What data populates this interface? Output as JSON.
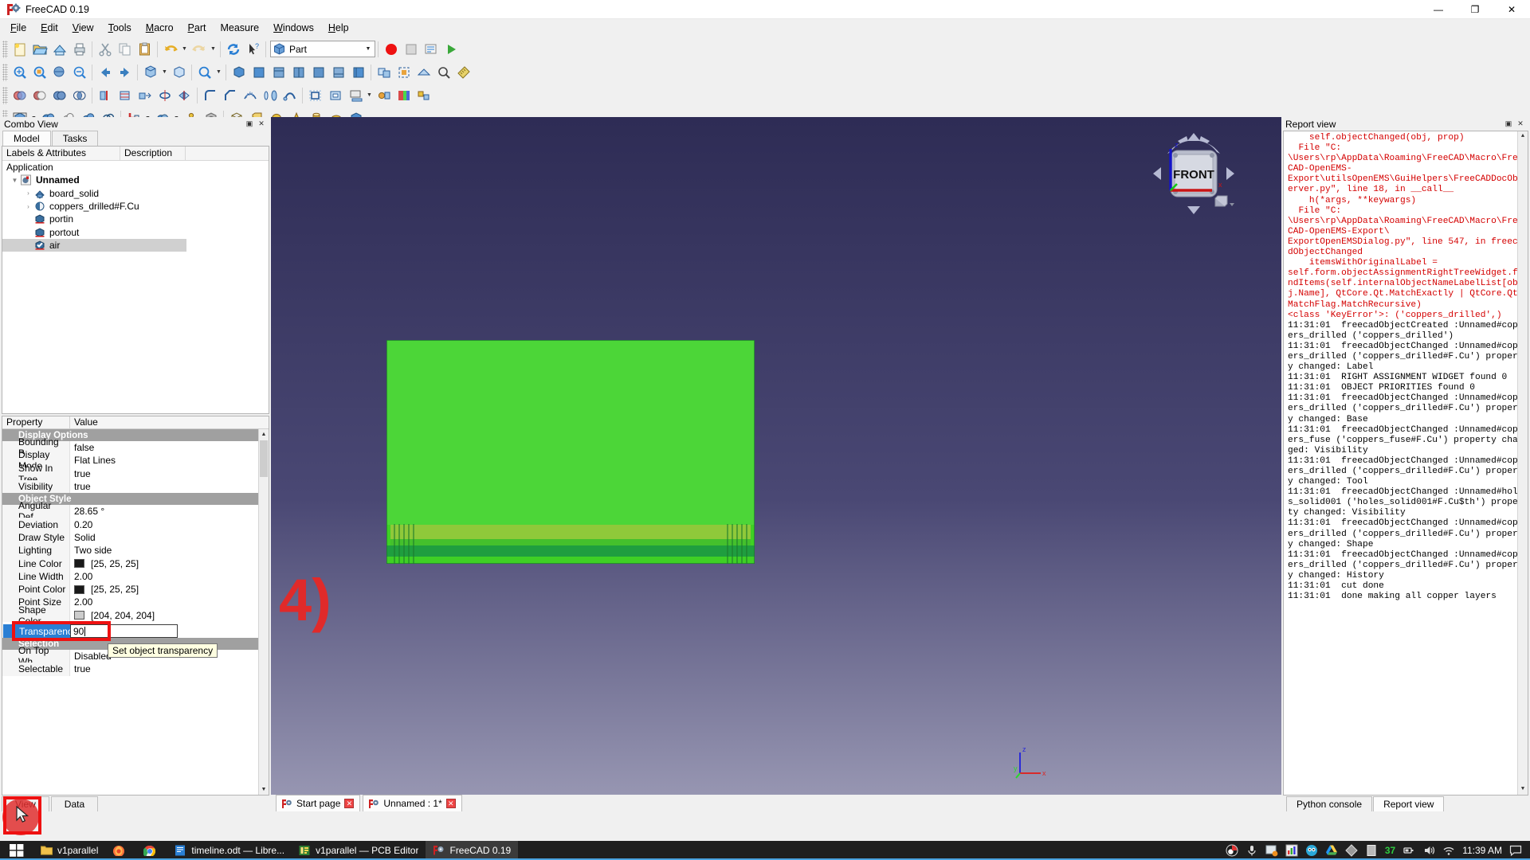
{
  "window": {
    "title": "FreeCAD 0.19",
    "icon": "freecad-icon",
    "minimize": "—",
    "maximize": "❐",
    "close": "✕"
  },
  "menubar": {
    "items": [
      {
        "label": "File",
        "mnemonic": "F"
      },
      {
        "label": "Edit",
        "mnemonic": "E"
      },
      {
        "label": "View",
        "mnemonic": "V"
      },
      {
        "label": "Tools",
        "mnemonic": "T"
      },
      {
        "label": "Macro",
        "mnemonic": "M"
      },
      {
        "label": "Part",
        "mnemonic": "P"
      },
      {
        "label": "Measure",
        "mnemonic": "M"
      },
      {
        "label": "Windows",
        "mnemonic": "W"
      },
      {
        "label": "Help",
        "mnemonic": "H"
      }
    ]
  },
  "toolbar": {
    "workbench_selector": {
      "value": "Part",
      "icon": "part-workbench-icon"
    },
    "file_buttons": [
      "new-document-icon",
      "open-document-icon",
      "save-document-icon",
      "print-icon",
      "cut-icon",
      "copy-icon",
      "paste-icon",
      "undo-icon",
      "redo-icon",
      "refresh-icon",
      "whats-this-icon"
    ],
    "macro_buttons": [
      "macro-record-icon",
      "macro-stop-icon",
      "macro-edit-icon",
      "macro-execute-icon"
    ],
    "row2_buttons": [
      "fit-all-icon",
      "fit-selection-icon",
      "draw-style-icon",
      "freeze-view-icon",
      "back-arrow-icon",
      "forward-arrow-icon",
      "std-views-icon",
      "axonometric-icon",
      "zoom-icon",
      "isometric-view-icon",
      "front-view-icon",
      "top-view-icon",
      "right-view-icon",
      "rear-view-icon",
      "bottom-view-icon",
      "left-view-icon",
      "measure-icon",
      "box-element-icon",
      "box-selection-icon",
      "clipping-plane-icon",
      "scene-inspector-icon"
    ],
    "row3_buttons": [
      "boolean-icon",
      "cut-icon",
      "union-icon",
      "common-icon",
      "section-icon",
      "cross-sections-icon",
      "extrude-icon",
      "revolve-icon",
      "mirror-icon",
      "fillet-icon",
      "chamfer-icon",
      "ruled-surface-icon",
      "loft-icon",
      "sweep-icon",
      "offset-icon",
      "thickness-icon",
      "projection-icon",
      "attachment-icon",
      "color-per-face-icon",
      "shape-builder-icon"
    ],
    "row4_buttons": [
      "primitives-icon",
      "sphere-icon",
      "ellipsoid-icon",
      "cylinder-icon",
      "cone-icon",
      "torus-icon",
      "tube-icon",
      "box-icon",
      "cube-icon",
      "cylinder2-icon",
      "cone2-icon",
      "sphere2-icon",
      "wedge-icon"
    ]
  },
  "combo_view": {
    "title": "Combo View",
    "float_btn": "float-icon",
    "close_btn": "close-icon",
    "tabs": [
      {
        "label": "Model",
        "active": true
      },
      {
        "label": "Tasks",
        "active": false
      }
    ],
    "tree": {
      "headers": [
        "Labels & Attributes",
        "Description",
        ""
      ],
      "items": [
        {
          "label": "Application",
          "indent": 0,
          "expander": "",
          "icon": "",
          "bold": false,
          "selected": false
        },
        {
          "label": "Unnamed",
          "indent": 1,
          "expander": "▾",
          "icon": "document-icon",
          "bold": true,
          "selected": false
        },
        {
          "label": "board_solid",
          "indent": 2,
          "expander": "›",
          "icon": "solid-shape-icon",
          "bold": false,
          "selected": false
        },
        {
          "label": "coppers_drilled#F.Cu",
          "indent": 2,
          "expander": "›",
          "icon": "boolean-cut-icon",
          "bold": false,
          "selected": false
        },
        {
          "label": "portin",
          "indent": 2,
          "expander": "",
          "icon": "box-icon",
          "bold": false,
          "selected": false
        },
        {
          "label": "portout",
          "indent": 2,
          "expander": "",
          "icon": "box-icon",
          "bold": false,
          "selected": false
        },
        {
          "label": "air",
          "indent": 2,
          "expander": "",
          "icon": "box-checked-icon",
          "bold": false,
          "selected": true
        }
      ]
    },
    "property_editor": {
      "headers": [
        "Property",
        "Value"
      ],
      "rows": [
        {
          "type": "group",
          "name": "Display Options"
        },
        {
          "type": "prop",
          "name": "Bounding B...",
          "value": "false"
        },
        {
          "type": "prop",
          "name": "Display Mode",
          "value": "Flat Lines"
        },
        {
          "type": "prop",
          "name": "Show In Tree",
          "value": "true"
        },
        {
          "type": "prop",
          "name": "Visibility",
          "value": "true"
        },
        {
          "type": "group",
          "name": "Object Style"
        },
        {
          "type": "prop",
          "name": "Angular Def...",
          "value": "28.65 °"
        },
        {
          "type": "prop",
          "name": "Deviation",
          "value": "0.20"
        },
        {
          "type": "prop",
          "name": "Draw Style",
          "value": "Solid"
        },
        {
          "type": "prop",
          "name": "Lighting",
          "value": "Two side"
        },
        {
          "type": "prop",
          "name": "Line Color",
          "value": "[25, 25, 25]",
          "swatch": "#191919"
        },
        {
          "type": "prop",
          "name": "Line Width",
          "value": "2.00"
        },
        {
          "type": "prop",
          "name": "Point Color",
          "value": "[25, 25, 25]",
          "swatch": "#191919"
        },
        {
          "type": "prop",
          "name": "Point Size",
          "value": "2.00"
        },
        {
          "type": "prop",
          "name": "Shape Color",
          "value": "[204, 204, 204]",
          "swatch": "#cccccc"
        },
        {
          "type": "editing",
          "name": "Transparency",
          "value": "90"
        },
        {
          "type": "group",
          "name": "Selection"
        },
        {
          "type": "prop",
          "name": "On Top Wh...",
          "value": "Disabled"
        },
        {
          "type": "prop",
          "name": "Selectable",
          "value": "true"
        }
      ],
      "tooltip": "Set object transparency",
      "highlight_color": "#ee1111",
      "selected_row_color": "#2a7fd4"
    },
    "bottom_tabs": [
      {
        "label": "View",
        "active": true
      },
      {
        "label": "Data",
        "active": false
      }
    ]
  },
  "view3d": {
    "nav_cube_label": "FRONT",
    "axis_labels": {
      "x": "x",
      "y": "y",
      "z": "z"
    },
    "annotation": "4)",
    "annotation_color": "#e02a2a",
    "board_color_top": "#4cd638",
    "board_color_trace": "#8fc93a",
    "board_color_edge": "#1f9e3f",
    "background_top": "#2e2c55",
    "background_bottom": "#9b9ab5",
    "tabs": [
      {
        "label": "Start page",
        "icon": "freecad-icon",
        "active": false
      },
      {
        "label": "Unnamed : 1*",
        "icon": "freecad-icon",
        "active": true
      }
    ]
  },
  "report_view": {
    "title": "Report view",
    "float_btn": "float-icon",
    "close_btn": "close-icon",
    "lines": [
      {
        "text": "    self.objectChanged(obj, prop)",
        "kind": "err"
      },
      {
        "text": "  File \"C:",
        "kind": "err"
      },
      {
        "text": "\\Users\\rp\\AppData\\Roaming\\FreeCAD\\Macro\\FreeCAD-OpenEMS-",
        "kind": "err"
      },
      {
        "text": "Export\\utilsOpenEMS\\GuiHelpers\\FreeCADDocObserver.py\", line 18, in __call__",
        "kind": "err"
      },
      {
        "text": "    h(*args, **keywargs)",
        "kind": "err"
      },
      {
        "text": "  File \"C:",
        "kind": "err"
      },
      {
        "text": "\\Users\\rp\\AppData\\Roaming\\FreeCAD\\Macro\\FreeCAD-OpenEMS-Export\\",
        "kind": "err"
      },
      {
        "text": "ExportOpenEMSDialog.py\", line 547, in freecadObjectChanged",
        "kind": "err"
      },
      {
        "text": "    itemsWithOriginalLabel =",
        "kind": "err"
      },
      {
        "text": "self.form.objectAssignmentRightTreeWidget.findItems(self.internalObjectNameLabelList[obj.Name], QtCore.Qt.MatchExactly | QtCore.Qt.MatchFlag.MatchRecursive)",
        "kind": "err"
      },
      {
        "text": "<class 'KeyError'>: ('coppers_drilled',)",
        "kind": "err"
      },
      {
        "text": "11:31:01  freecadObjectCreated :Unnamed#coppers_drilled ('coppers_drilled')",
        "kind": "msg"
      },
      {
        "text": "11:31:01  freecadObjectChanged :Unnamed#coppers_drilled ('coppers_drilled#F.Cu') property changed: Label",
        "kind": "msg"
      },
      {
        "text": "11:31:01  RIGHT ASSIGNMENT WIDGET found 0",
        "kind": "msg"
      },
      {
        "text": "11:31:01  OBJECT PRIORITIES found 0",
        "kind": "msg"
      },
      {
        "text": "11:31:01  freecadObjectChanged :Unnamed#coppers_drilled ('coppers_drilled#F.Cu') property changed: Base",
        "kind": "msg"
      },
      {
        "text": "11:31:01  freecadObjectChanged :Unnamed#coppers_fuse ('coppers_fuse#F.Cu') property changed: Visibility",
        "kind": "msg"
      },
      {
        "text": "11:31:01  freecadObjectChanged :Unnamed#coppers_drilled ('coppers_drilled#F.Cu') property changed: Tool",
        "kind": "msg"
      },
      {
        "text": "11:31:01  freecadObjectChanged :Unnamed#holes_solid001 ('holes_solid001#F.Cu$th') property changed: Visibility",
        "kind": "msg"
      },
      {
        "text": "11:31:01  freecadObjectChanged :Unnamed#coppers_drilled ('coppers_drilled#F.Cu') property changed: Shape",
        "kind": "msg"
      },
      {
        "text": "11:31:01  freecadObjectChanged :Unnamed#coppers_drilled ('coppers_drilled#F.Cu') property changed: History",
        "kind": "msg"
      },
      {
        "text": "11:31:01  cut done",
        "kind": "msg"
      },
      {
        "text": "11:31:01  done making all copper layers",
        "kind": "msg"
      }
    ],
    "tabs": [
      {
        "label": "Python console",
        "active": false
      },
      {
        "label": "Report view",
        "active": true
      }
    ]
  },
  "taskbar": {
    "start_icon": "windows-start-icon",
    "apps": [
      {
        "label": "v1parallel",
        "icon": "folder-icon",
        "active": false
      },
      {
        "label": "",
        "icon": "firefox-icon",
        "active": false
      },
      {
        "label": "",
        "icon": "chrome-icon",
        "active": false
      },
      {
        "label": "timeline.odt — Libre...",
        "icon": "libreoffice-writer-icon",
        "active": false
      },
      {
        "label": "v1parallel — PCB Editor",
        "icon": "kicad-pcb-icon",
        "active": false
      },
      {
        "label": "FreeCAD 0.19",
        "icon": "freecad-icon",
        "active": true
      }
    ],
    "tray": {
      "icons": [
        "obs-icon",
        "microphone-icon",
        "sync-icon",
        "graph-icon",
        "owl-icon",
        "google-drive-icon",
        "diamond-icon",
        "note-icon"
      ],
      "battery_percent": "37",
      "power_icon": "plug-icon",
      "volume_icon": "speaker-icon",
      "network_icon": "wifi-icon",
      "clock": "11:39 AM",
      "notification_icon": "notification-icon"
    }
  }
}
